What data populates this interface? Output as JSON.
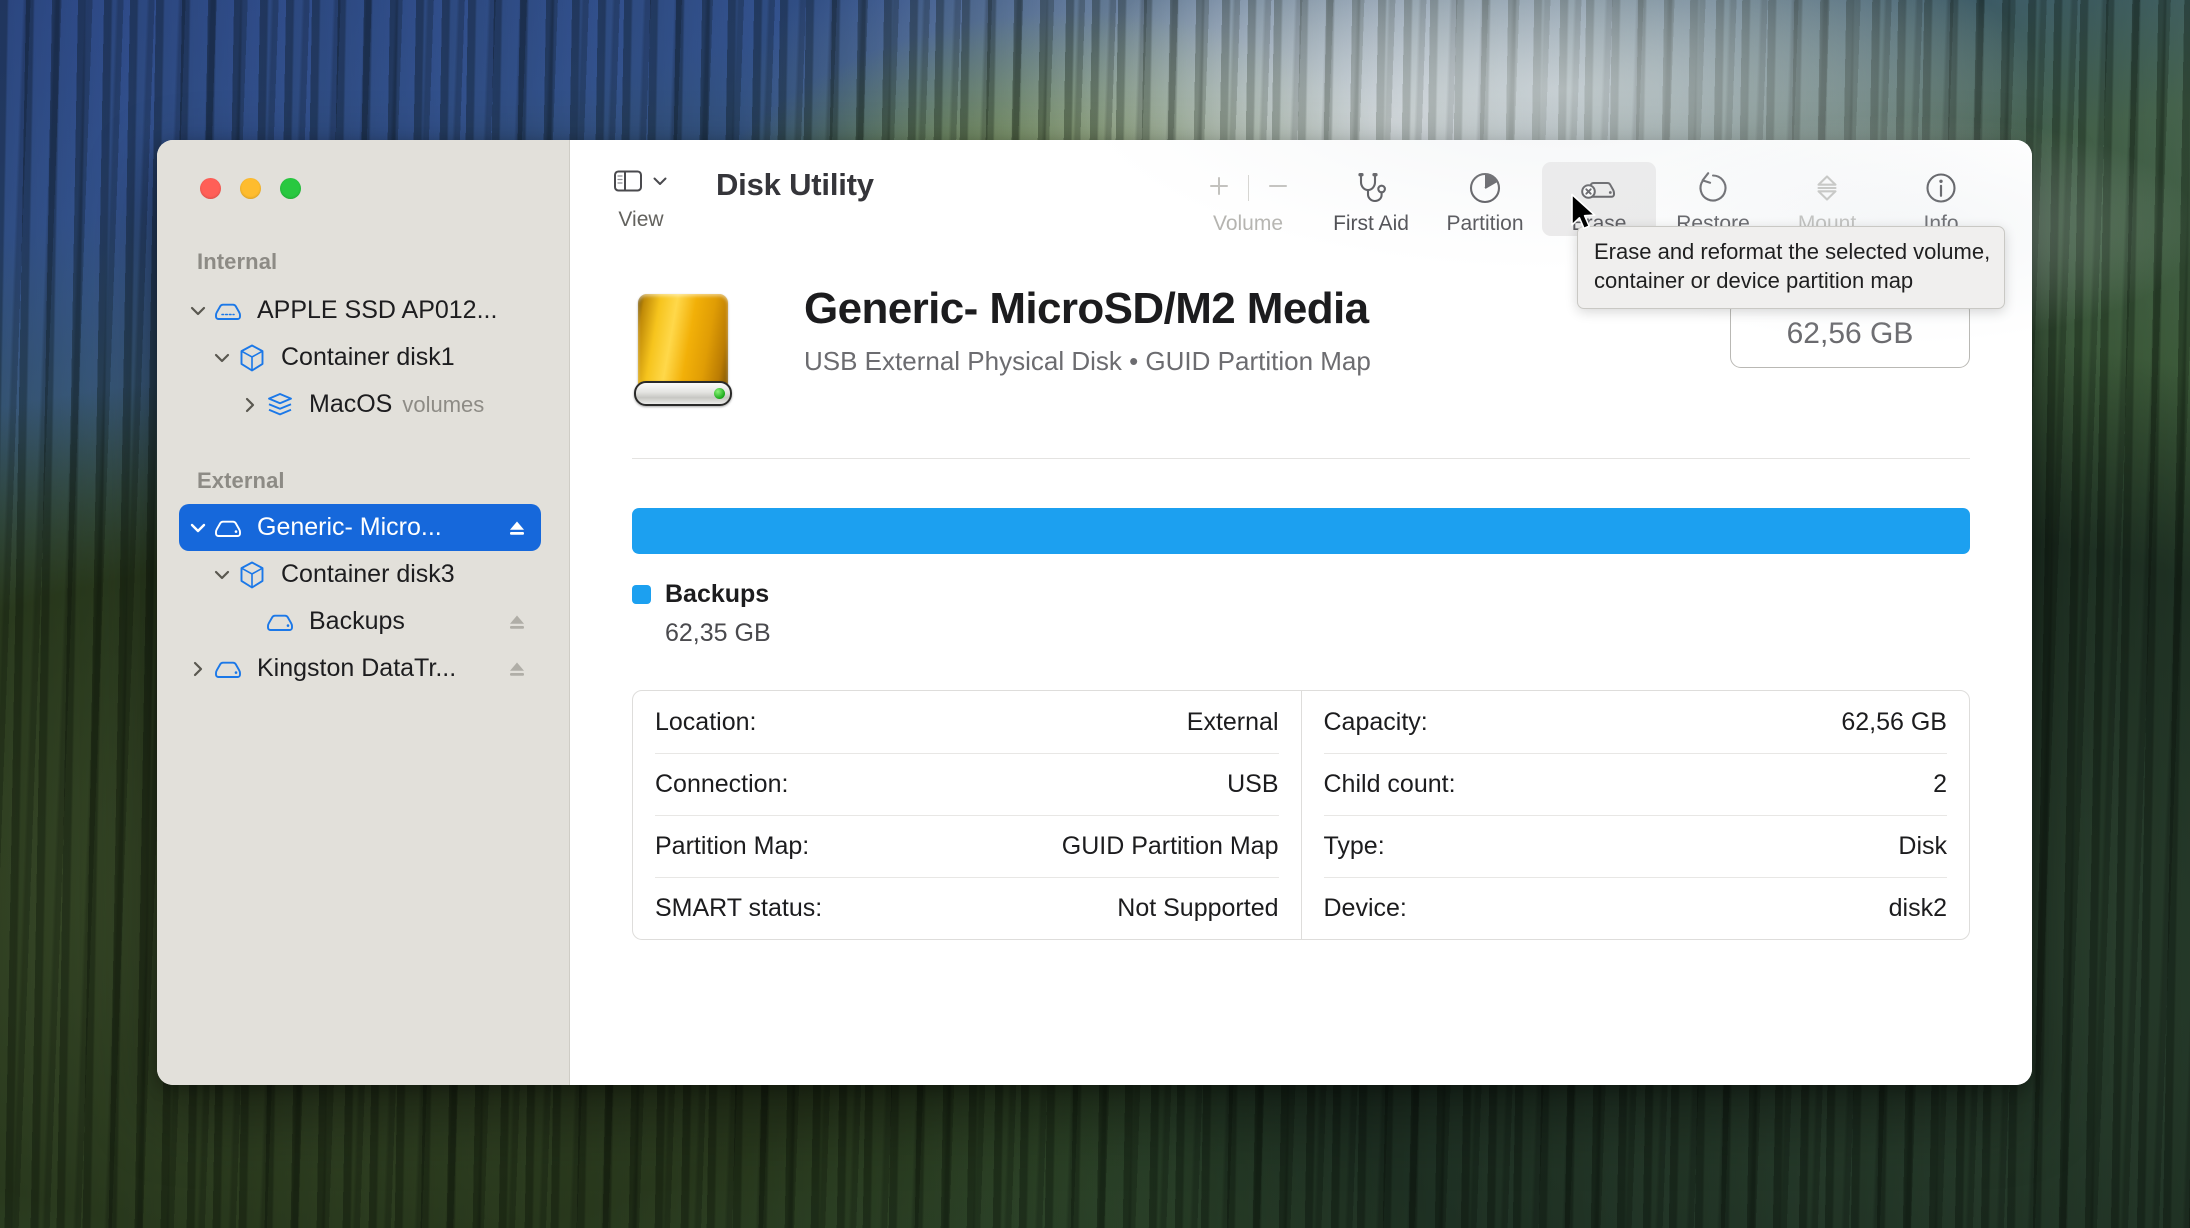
{
  "window": {
    "title": "Disk Utility",
    "traffic_lights": [
      "close",
      "minimize",
      "zoom"
    ]
  },
  "toolbar": {
    "view_label": "View",
    "volume_group": {
      "label": "Volume",
      "add": "+",
      "remove": "−",
      "enabled": false
    },
    "items": [
      {
        "label": "First Aid",
        "icon": "stethoscope-icon",
        "enabled": true,
        "hovered": false
      },
      {
        "label": "Partition",
        "icon": "pie-chart-icon",
        "enabled": true,
        "hovered": false
      },
      {
        "label": "Erase",
        "icon": "erase-disk-icon",
        "enabled": true,
        "hovered": true
      },
      {
        "label": "Restore",
        "icon": "restore-arrow-icon",
        "enabled": true,
        "hovered": false
      },
      {
        "label": "Mount",
        "icon": "mount-eject-icon",
        "enabled": false,
        "hovered": false
      },
      {
        "label": "Info",
        "icon": "info-circle-icon",
        "enabled": true,
        "hovered": false
      }
    ],
    "tooltip": "Erase and reformat the selected volume,\ncontainer or device partition map"
  },
  "sidebar": {
    "sections": [
      {
        "header": "Internal",
        "rows": [
          {
            "label": "APPLE SSD AP012...",
            "sub": "",
            "icon": "hard-disk-icon",
            "twisty": "chevron-down",
            "indent": 1,
            "selected": false,
            "eject": false
          },
          {
            "label": "Container disk1",
            "sub": "",
            "icon": "container-cube-icon",
            "twisty": "chevron-down",
            "indent": 2,
            "selected": false,
            "eject": false
          },
          {
            "label": "MacOS",
            "sub": "volumes",
            "icon": "volume-stack-icon",
            "twisty": "chevron-right",
            "indent": 3,
            "selected": false,
            "eject": false
          }
        ]
      },
      {
        "header": "External",
        "rows": [
          {
            "label": "Generic- Micro...",
            "sub": "",
            "icon": "hard-disk-icon",
            "twisty": "chevron-down",
            "indent": 1,
            "selected": true,
            "eject": true
          },
          {
            "label": "Container disk3",
            "sub": "",
            "icon": "container-cube-icon",
            "twisty": "chevron-down",
            "indent": 2,
            "selected": false,
            "eject": false
          },
          {
            "label": "Backups",
            "sub": "",
            "icon": "hard-disk-icon",
            "twisty": "none",
            "indent": 3,
            "selected": false,
            "eject": true
          },
          {
            "label": "Kingston DataTr...",
            "sub": "",
            "icon": "hard-disk-icon",
            "twisty": "chevron-right",
            "indent": 1,
            "selected": false,
            "eject": true
          }
        ]
      }
    ]
  },
  "disk": {
    "title": "Generic- MicroSD/M2 Media",
    "subtitle": "USB External Physical Disk • GUID Partition Map",
    "capacity_badge": "62,56 GB"
  },
  "usage": {
    "bar_fill_percent": 100,
    "bar_color": "#1ca0f0",
    "legend": [
      {
        "name": "Backups",
        "size": "62,35 GB",
        "color": "#1ca0f0"
      }
    ]
  },
  "info": {
    "left": [
      {
        "key": "Location:",
        "value": "External"
      },
      {
        "key": "Connection:",
        "value": "USB"
      },
      {
        "key": "Partition Map:",
        "value": "GUID Partition Map"
      },
      {
        "key": "SMART status:",
        "value": "Not Supported"
      }
    ],
    "right": [
      {
        "key": "Capacity:",
        "value": "62,56 GB"
      },
      {
        "key": "Child count:",
        "value": "2"
      },
      {
        "key": "Type:",
        "value": "Disk"
      },
      {
        "key": "Device:",
        "value": "disk2"
      }
    ]
  },
  "colors": {
    "selection_blue": "#1668db",
    "usage_blue": "#1ca0f0",
    "sidebar_bg": "#e2e0da",
    "traffic_red": "#ff5f57",
    "traffic_yellow": "#febc2e",
    "traffic_green": "#28c840"
  }
}
